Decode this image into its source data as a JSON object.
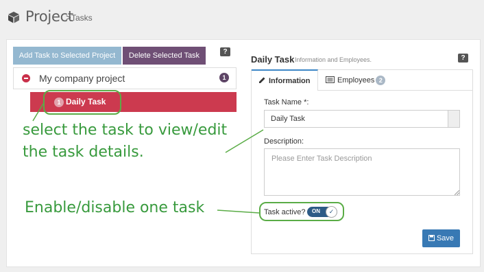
{
  "header": {
    "title": "Project",
    "breadcrumb_sep": ">",
    "breadcrumb": "Tasks"
  },
  "toolbar": {
    "add_label": "Add Task to Selected Project",
    "delete_label": "Delete Selected Task",
    "help": "?"
  },
  "tree": {
    "root": {
      "label": "My company project",
      "count": "1"
    },
    "task": {
      "label": "Daily Task",
      "count": "1"
    }
  },
  "annotations": {
    "select_line1": "select the task to view/edit",
    "select_line2": "the task details.",
    "enable": "Enable/disable one task"
  },
  "detail": {
    "title": "Daily Task",
    "subtitle": "Information and Employees.",
    "help": "?",
    "tabs": [
      {
        "label": "Information",
        "icon": "pencil-icon"
      },
      {
        "label": "Employees",
        "icon": "list-icon",
        "count": "2"
      }
    ],
    "task_name_label": "Task Name *:",
    "task_name_value": "Daily Task",
    "description_label": "Description:",
    "description_placeholder": "Please Enter Task Description",
    "active_label": "Task active?",
    "active_toggle": "ON",
    "save_label": "Save"
  },
  "colors": {
    "accent": "#3879b4",
    "danger": "#cc3a4f",
    "purple": "#6f4f75",
    "annotation": "#389a3d"
  }
}
